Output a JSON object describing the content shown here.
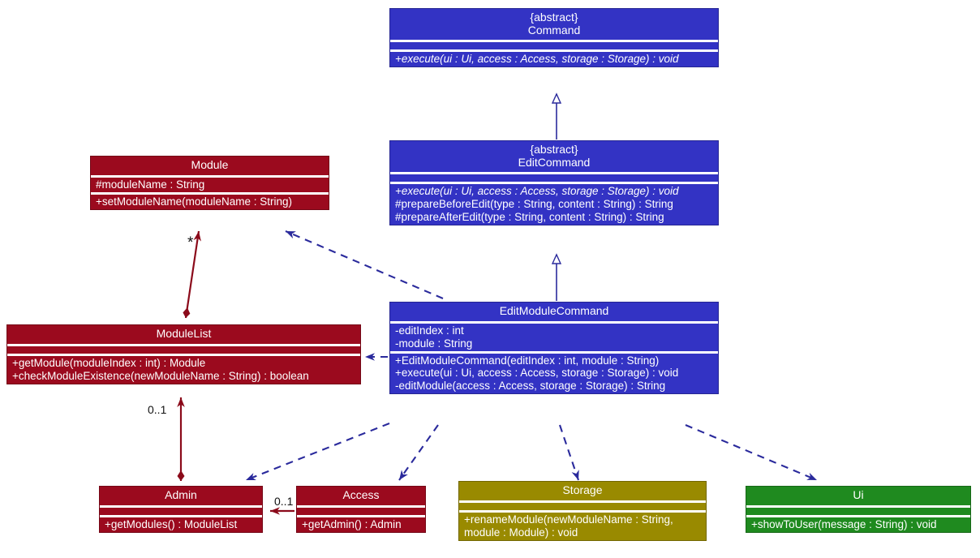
{
  "diagram": {
    "title": "EditModuleCommand class diagram",
    "type": "uml-class-diagram",
    "colors": {
      "blue": "#3333C4",
      "dark_red": "#9B0A1E",
      "gold": "#998A00",
      "green": "#1F8A1F",
      "relation_blue": "#2A2A9C",
      "relation_red": "#8B0A1A",
      "background": "#FFFFFF",
      "text": "#FFFFFF"
    }
  },
  "classes": {
    "command": {
      "stereotype": "{abstract}",
      "name": "Command",
      "attributes": [],
      "methods": [
        "+execute(ui : Ui, access : Access, storage : Storage) : void"
      ]
    },
    "edit_command": {
      "stereotype": "{abstract}",
      "name": "EditCommand",
      "attributes": [],
      "methods": [
        "+execute(ui : Ui, access : Access, storage : Storage) : void",
        "#prepareBeforeEdit(type : String, content : String) : String",
        "#prepareAfterEdit(type : String, content : String) : String"
      ]
    },
    "edit_module_command": {
      "stereotype": "",
      "name": "EditModuleCommand",
      "attributes": [
        "-editIndex : int",
        "-module : String"
      ],
      "methods": [
        "+EditModuleCommand(editIndex : int, module : String)",
        "+execute(ui : Ui, access : Access, storage : Storage) : void",
        "-editModule(access : Access, storage : Storage) : String"
      ]
    },
    "module": {
      "stereotype": "",
      "name": "Module",
      "attributes": [
        "#moduleName : String"
      ],
      "methods": [
        "+setModuleName(moduleName : String)"
      ]
    },
    "module_list": {
      "stereotype": "",
      "name": "ModuleList",
      "attributes": [],
      "methods": [
        "+getModule(moduleIndex : int) : Module",
        "+checkModuleExistence(newModuleName : String) : boolean"
      ]
    },
    "admin": {
      "stereotype": "",
      "name": "Admin",
      "attributes": [],
      "methods": [
        "+getModules() : ModuleList"
      ]
    },
    "access": {
      "stereotype": "",
      "name": "Access",
      "attributes": [],
      "methods": [
        "+getAdmin() : Admin"
      ]
    },
    "storage": {
      "stereotype": "",
      "name": "Storage",
      "attributes": [],
      "methods": [
        "+renameModule(newModuleName : String,\nmodule : Module) : void"
      ]
    },
    "ui": {
      "stereotype": "",
      "name": "Ui",
      "attributes": [],
      "methods": [
        "+showToUser(message : String) : void"
      ]
    }
  },
  "relations": [
    {
      "id": "editcommand-generalizes-command",
      "from": "EditCommand",
      "to": "Command",
      "kind": "generalization",
      "style": "solid",
      "label": ""
    },
    {
      "id": "editmodulecommand-generalizes-editcommand",
      "from": "EditModuleCommand",
      "to": "EditCommand",
      "kind": "generalization",
      "style": "solid",
      "label": ""
    },
    {
      "id": "editmodulecommand-depends-module",
      "from": "EditModuleCommand",
      "to": "Module",
      "kind": "dependency",
      "style": "dashed",
      "label": ""
    },
    {
      "id": "editmodulecommand-depends-modulelist",
      "from": "EditModuleCommand",
      "to": "ModuleList",
      "kind": "dependency",
      "style": "dashed",
      "label": ""
    },
    {
      "id": "editmodulecommand-depends-admin",
      "from": "EditModuleCommand",
      "to": "Admin",
      "kind": "dependency",
      "style": "dashed",
      "label": ""
    },
    {
      "id": "editmodulecommand-depends-access",
      "from": "EditModuleCommand",
      "to": "Access",
      "kind": "dependency",
      "style": "dashed",
      "label": ""
    },
    {
      "id": "editmodulecommand-depends-storage",
      "from": "EditModuleCommand",
      "to": "Storage",
      "kind": "dependency",
      "style": "dashed",
      "label": ""
    },
    {
      "id": "editmodulecommand-depends-ui",
      "from": "EditModuleCommand",
      "to": "Ui",
      "kind": "dependency",
      "style": "dashed",
      "label": ""
    },
    {
      "id": "modulelist-composes-module",
      "from": "ModuleList",
      "to": "Module",
      "kind": "composition",
      "style": "solid",
      "label": "*"
    },
    {
      "id": "admin-composes-modulelist",
      "from": "Admin",
      "to": "ModuleList",
      "kind": "composition",
      "style": "solid",
      "label": "0..1"
    },
    {
      "id": "access-association-admin",
      "from": "Access",
      "to": "Admin",
      "kind": "association",
      "style": "solid",
      "label": "0..1"
    }
  ],
  "multiplicity_labels": {
    "module_list_to_module": "*",
    "admin_to_module_list": "0..1",
    "access_to_admin": "0..1"
  }
}
